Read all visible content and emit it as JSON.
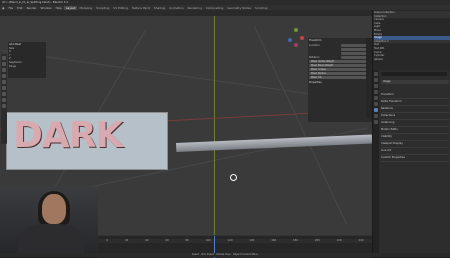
{
  "window": {
    "title": "(D:\\...\\Blend_a\\_D\\_a\\_Splitting.blend) - Blender 3.4"
  },
  "menu": {
    "items": [
      "File",
      "Edit",
      "Render",
      "Window",
      "Help"
    ],
    "workspaces": [
      "Layout",
      "Modeling",
      "Sculpting",
      "UV Editing",
      "Texture Paint",
      "Shading",
      "Animation",
      "Rendering",
      "Compositing",
      "Geometry Nodes",
      "Scripting"
    ],
    "active_workspace": "Layout"
  },
  "tool_panel": {
    "title": "Add Mesh",
    "rows": [
      "Size",
      "X",
      "Y",
      "Z",
      "Segments",
      "Rings"
    ]
  },
  "n_panel": {
    "header": "Transform",
    "rows": [
      {
        "label": "Location",
        "value": "0 m"
      },
      {
        "label": "",
        "value": "0 m"
      },
      {
        "label": "",
        "value": "0 m"
      },
      {
        "label": "Rotation",
        "value": "0°"
      }
    ],
    "buttons": [
      "Mean Vertex Weight",
      "Mean Bevel Weight",
      "Mean Crease",
      "Mean Radius",
      "Mean Tilt"
    ],
    "footer": "Properties"
  },
  "outliner": {
    "rows": [
      {
        "name": "Scene Collection",
        "selected": false,
        "collection": true
      },
      {
        "name": "Collection",
        "selected": false,
        "collection": true
      },
      {
        "name": "Camera",
        "selected": false,
        "collection": false
      },
      {
        "name": "Cube",
        "selected": false,
        "collection": false
      },
      {
        "name": "Light",
        "selected": false,
        "collection": false
      },
      {
        "name": "Plane",
        "selected": false,
        "collection": false
      },
      {
        "name": "Empty",
        "selected": false,
        "collection": false
      },
      {
        "name": "Image",
        "selected": true,
        "collection": false
      },
      {
        "name": "Collection 2",
        "selected": false,
        "collection": true
      },
      {
        "name": "Text",
        "selected": false,
        "collection": false
      },
      {
        "name": "Text.001",
        "selected": false,
        "collection": false
      },
      {
        "name": "Curve",
        "selected": false,
        "collection": false
      },
      {
        "name": "Cylinder",
        "selected": false,
        "collection": false
      },
      {
        "name": "Sphere",
        "selected": false,
        "collection": false
      }
    ]
  },
  "properties": {
    "object_name": "Image",
    "sections": [
      "Transform",
      "Delta Transform",
      "Relations",
      "Collections",
      "Instancing",
      "Motion Paths",
      "Visibility",
      "Viewport Display",
      "Line Art",
      "Custom Properties"
    ]
  },
  "viewport": {
    "ref_text": "DARK"
  },
  "timeline": {
    "ticks": [
      "0",
      "20",
      "40",
      "60",
      "80",
      "100",
      "120",
      "140",
      "160",
      "180",
      "200",
      "220",
      "240"
    ]
  },
  "statusbar": {
    "text": "Select · Box Select · Rotate View · Object Context Menu"
  }
}
